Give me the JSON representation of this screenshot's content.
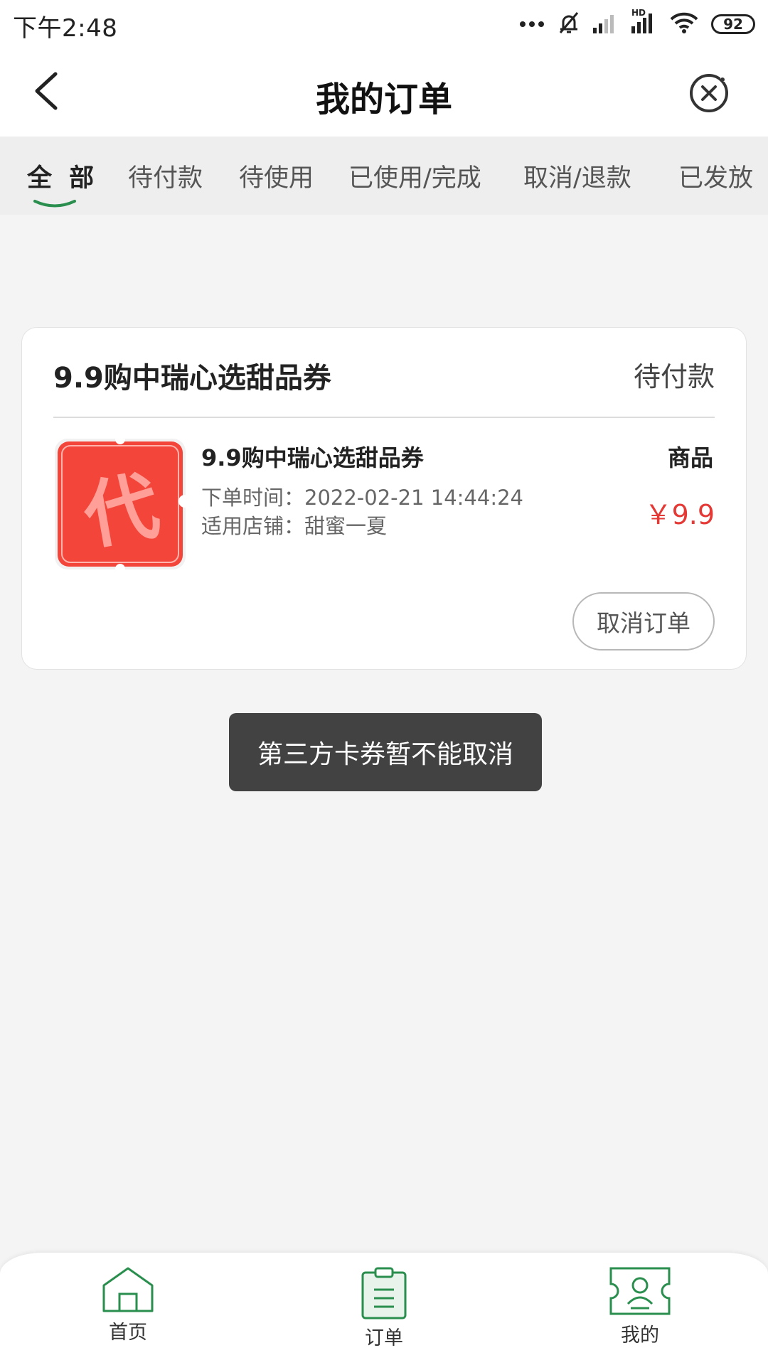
{
  "status_bar": {
    "time": "下午2:48",
    "battery": "92",
    "hd_label": "HD"
  },
  "header": {
    "title": "我的订单"
  },
  "tabs": [
    {
      "label": "全 部",
      "active": true
    },
    {
      "label": "待付款"
    },
    {
      "label": "待使用"
    },
    {
      "label": "已使用/完成"
    },
    {
      "label": "取消/退款"
    },
    {
      "label": "已发放"
    }
  ],
  "order": {
    "title": "9.9购中瑞心选甜品券",
    "status": "待付款",
    "thumbnail_char": "代",
    "item_name": "9.9购中瑞心选甜品券",
    "order_time": "下单时间：2022-02-21 14:44:24",
    "store": "适用店铺：甜蜜一夏",
    "type_label": "商品",
    "price": "￥9.9",
    "cancel_label": "取消订单"
  },
  "toast": {
    "message": "第三方卡券暂不能取消"
  },
  "bottom_nav": [
    {
      "label": "首页",
      "icon": "home-icon"
    },
    {
      "label": "订单",
      "icon": "orders-icon"
    },
    {
      "label": "我的",
      "icon": "profile-card-icon"
    }
  ],
  "colors": {
    "accent_green": "#2a8f4e",
    "price_red": "#e53935",
    "thumb_red": "#f4453a"
  }
}
